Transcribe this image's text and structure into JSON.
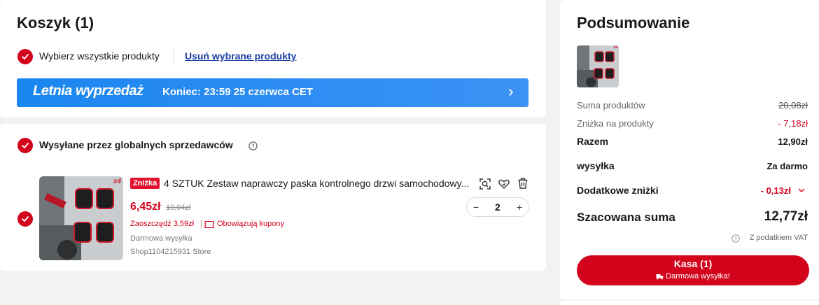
{
  "cart": {
    "title": "Koszyk (1)",
    "select_all_label": "Wybierz wszystkie produkty",
    "remove_selected_label": "Usuń wybrane produkty",
    "banner": {
      "title": "Letnia wyprzedaż",
      "subtitle": "Koniec: 23:59 25 czerwca CET"
    }
  },
  "seller_group": {
    "title": "Wysyłane przez globalnych sprzedawców",
    "product": {
      "badge": "Zniżka",
      "image_tag": "x4",
      "name": "4 SZTUK Zestaw naprawczy paska kontrolnego drzwi samochodowy...",
      "price": "6,45zł",
      "old_price": "10,04zł",
      "savings": "Zaoszczędź 3,59zł",
      "coupons": "Obowiązują kupony",
      "shipping": "Darmowa wysyłka",
      "store": "Shop1104215931 Store",
      "quantity": "2",
      "qty_minus": "−",
      "qty_plus": "+"
    }
  },
  "summary": {
    "title": "Podsumowanie",
    "image_tag": "x4",
    "products_total_label": "Suma produktów",
    "products_total_value": "20,08zł",
    "discount_label": "Zniżka na produkty",
    "discount_value": "- 7,18zł",
    "subtotal_label": "Razem",
    "subtotal_value": "12,90zł",
    "shipping_label": "wysyłka",
    "shipping_value": "Za darmo",
    "extra_discounts_label": "Dodatkowe zniżki",
    "extra_discounts_value": "- 0,13zł",
    "estimated_total_label": "Szacowana suma",
    "estimated_total_value": "12,77zł",
    "vat_note": "Z podatkiem VAT",
    "checkout_label": "Kasa (1)",
    "checkout_sub": "Darmowa wysyłka!"
  },
  "colors": {
    "brand_red": "#d3031c",
    "link_blue": "#1b3fa6",
    "banner_blue": "#2f8df3"
  }
}
